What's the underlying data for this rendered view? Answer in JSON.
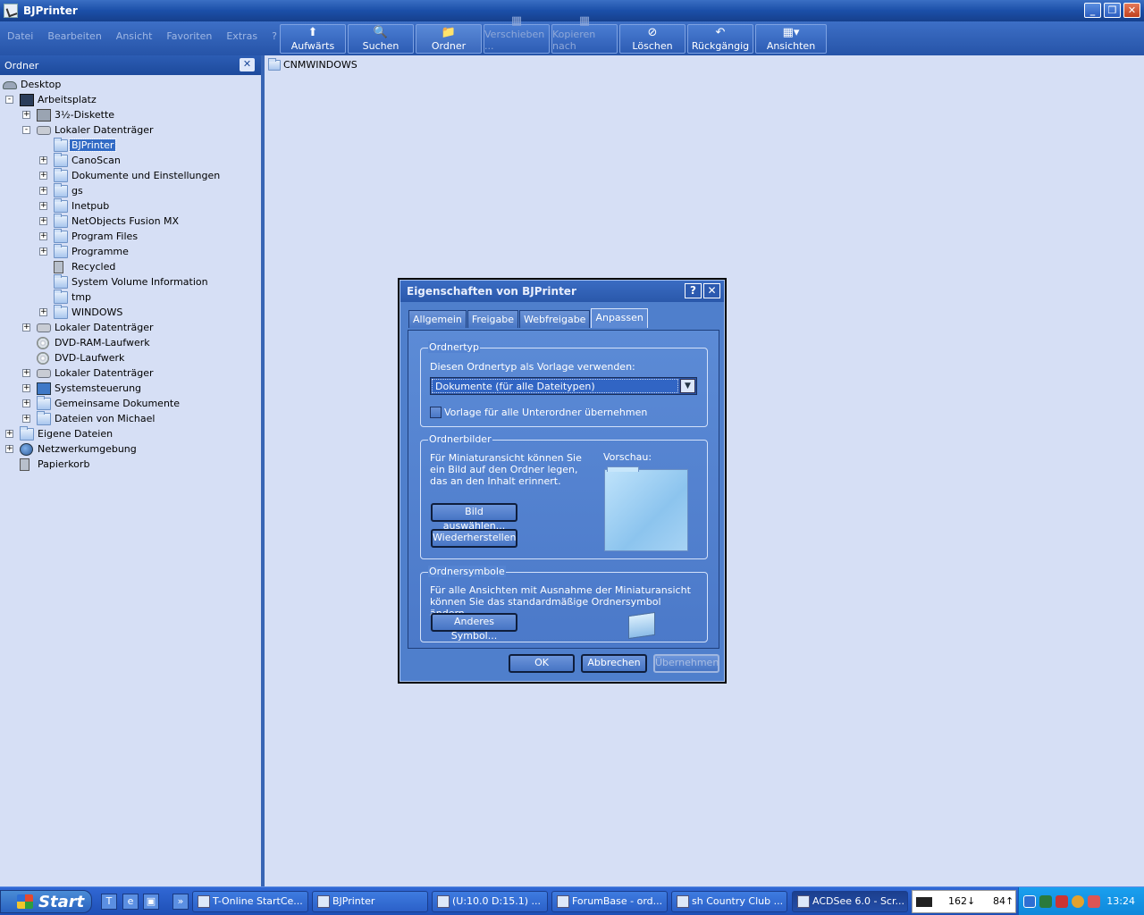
{
  "window": {
    "title": "BJPrinter"
  },
  "menu": [
    "Datei",
    "Bearbeiten",
    "Ansicht",
    "Favoriten",
    "Extras",
    "?"
  ],
  "toolbar": [
    {
      "label": "Aufwärts",
      "icon": "up-folder-icon",
      "glyph": "⬆",
      "state": "normal"
    },
    {
      "label": "Suchen",
      "icon": "search-icon",
      "glyph": "🔍",
      "state": "normal"
    },
    {
      "label": "Ordner",
      "icon": "folders-icon",
      "glyph": "📁",
      "state": "active"
    },
    {
      "label": "Verschieben ...",
      "icon": "move-to-icon",
      "glyph": "▦",
      "state": "disabled"
    },
    {
      "label": "Kopieren nach",
      "icon": "copy-to-icon",
      "glyph": "▦",
      "state": "disabled"
    },
    {
      "label": "Löschen",
      "icon": "delete-icon",
      "glyph": "⊘",
      "state": "normal"
    },
    {
      "label": "Rückgängig",
      "icon": "undo-icon",
      "glyph": "↶",
      "state": "normal"
    },
    {
      "label": "Ansichten",
      "icon": "views-icon",
      "glyph": "▦▾",
      "state": "normal"
    }
  ],
  "folder_pane": {
    "title": "Ordner",
    "close_glyph": "✕",
    "tree": [
      {
        "label": "Desktop",
        "level": 0,
        "icon": "desktop-icon",
        "expander": ""
      },
      {
        "label": "Arbeitsplatz",
        "level": 1,
        "icon": "computer-icon",
        "expander": "-"
      },
      {
        "label": "3½-Diskette",
        "level": 2,
        "icon": "floppy-icon",
        "expander": "+"
      },
      {
        "label": "Lokaler Datenträger",
        "level": 2,
        "icon": "drive-icon",
        "expander": "-"
      },
      {
        "label": "BJPrinter",
        "level": 3,
        "icon": "folder-icon",
        "expander": "",
        "selected": true
      },
      {
        "label": "CanoScan",
        "level": 3,
        "icon": "folder-icon",
        "expander": "+"
      },
      {
        "label": "Dokumente und Einstellungen",
        "level": 3,
        "icon": "folder-icon",
        "expander": "+"
      },
      {
        "label": "gs",
        "level": 3,
        "icon": "folder-icon",
        "expander": "+"
      },
      {
        "label": "Inetpub",
        "level": 3,
        "icon": "folder-icon",
        "expander": "+"
      },
      {
        "label": "NetObjects Fusion MX",
        "level": 3,
        "icon": "folder-icon",
        "expander": "+"
      },
      {
        "label": "Program Files",
        "level": 3,
        "icon": "folder-icon",
        "expander": "+"
      },
      {
        "label": "Programme",
        "level": 3,
        "icon": "folder-icon",
        "expander": "+"
      },
      {
        "label": "Recycled",
        "level": 3,
        "icon": "recycle-bin-icon",
        "expander": ""
      },
      {
        "label": "System Volume Information",
        "level": 3,
        "icon": "folder-icon",
        "expander": ""
      },
      {
        "label": "tmp",
        "level": 3,
        "icon": "folder-icon",
        "expander": ""
      },
      {
        "label": "WINDOWS",
        "level": 3,
        "icon": "folder-icon",
        "expander": "+"
      },
      {
        "label": "Lokaler Datenträger",
        "level": 2,
        "icon": "drive-icon",
        "expander": "+"
      },
      {
        "label": "DVD-RAM-Laufwerk",
        "level": 2,
        "icon": "cd-drive-icon",
        "expander": ""
      },
      {
        "label": "DVD-Laufwerk",
        "level": 2,
        "icon": "cd-drive-icon",
        "expander": ""
      },
      {
        "label": "Lokaler Datenträger",
        "level": 2,
        "icon": "drive-icon",
        "expander": "+"
      },
      {
        "label": "Systemsteuerung",
        "level": 2,
        "icon": "control-panel-icon",
        "expander": "+"
      },
      {
        "label": "Gemeinsame Dokumente",
        "level": 2,
        "icon": "folder-icon",
        "expander": "+"
      },
      {
        "label": "Dateien von Michael",
        "level": 2,
        "icon": "folder-icon",
        "expander": "+"
      },
      {
        "label": "Eigene Dateien",
        "level": 1,
        "icon": "my-documents-icon",
        "expander": "+"
      },
      {
        "label": "Netzwerkumgebung",
        "level": 1,
        "icon": "network-icon",
        "expander": "+"
      },
      {
        "label": "Papierkorb",
        "level": 1,
        "icon": "recycle-bin-icon",
        "expander": ""
      }
    ]
  },
  "content": {
    "items": [
      {
        "label": "CNMWINDOWS",
        "icon": "folder-icon"
      }
    ]
  },
  "dialog": {
    "title": "Eigenschaften von BJPrinter",
    "help_glyph": "?",
    "close_glyph": "✕",
    "tabs": [
      {
        "label": "Allgemein",
        "active": false
      },
      {
        "label": "Freigabe",
        "active": false
      },
      {
        "label": "Webfreigabe",
        "active": false
      },
      {
        "label": "Anpassen",
        "active": true
      }
    ],
    "ordnertyp": {
      "title": "Ordnertyp",
      "prompt": "Diesen Ordnertyp als Vorlage verwenden:",
      "selected": "Dokumente (für alle Dateitypen)",
      "checkbox_label": "Vorlage für alle Unterordner übernehmen",
      "checked": false
    },
    "ordnerbilder": {
      "title": "Ordnerbilder",
      "text": "Für Miniaturansicht können Sie ein Bild auf den Ordner legen, das an den Inhalt erinnert.",
      "preview_label": "Vorschau:",
      "choose_button": "Bild auswählen...",
      "restore_button": "Wiederherstellen"
    },
    "ordnersymbole": {
      "title": "Ordnersymbole",
      "text": "Für alle Ansichten mit Ausnahme der Miniaturansicht können Sie das standardmäßige Ordnersymbol ändern.",
      "change_button": "Anderes Symbol..."
    },
    "buttons": {
      "ok": "OK",
      "cancel": "Abbrechen",
      "apply": "Übernehmen"
    }
  },
  "taskbar": {
    "start": "Start",
    "quicklaunch": [
      {
        "name": "t-online-icon",
        "glyph": "T"
      },
      {
        "name": "internet-explorer-icon",
        "glyph": "e"
      },
      {
        "name": "show-desktop-icon",
        "glyph": "▣"
      },
      {
        "name": "more-icon",
        "glyph": "»"
      }
    ],
    "tasks": [
      {
        "label": "T-Online StartCe...",
        "active": false
      },
      {
        "label": "BJPrinter",
        "active": false
      },
      {
        "label": "(U:10.0 D:15.1) ...",
        "active": false
      },
      {
        "label": "ForumBase - ord...",
        "active": false
      },
      {
        "label": "sh Country Club ...",
        "active": false
      },
      {
        "label": "ACDSee 6.0 - Scr...",
        "active": true
      }
    ],
    "meter": {
      "down": "162↓",
      "up": "84↑"
    },
    "clock": "13:24"
  }
}
